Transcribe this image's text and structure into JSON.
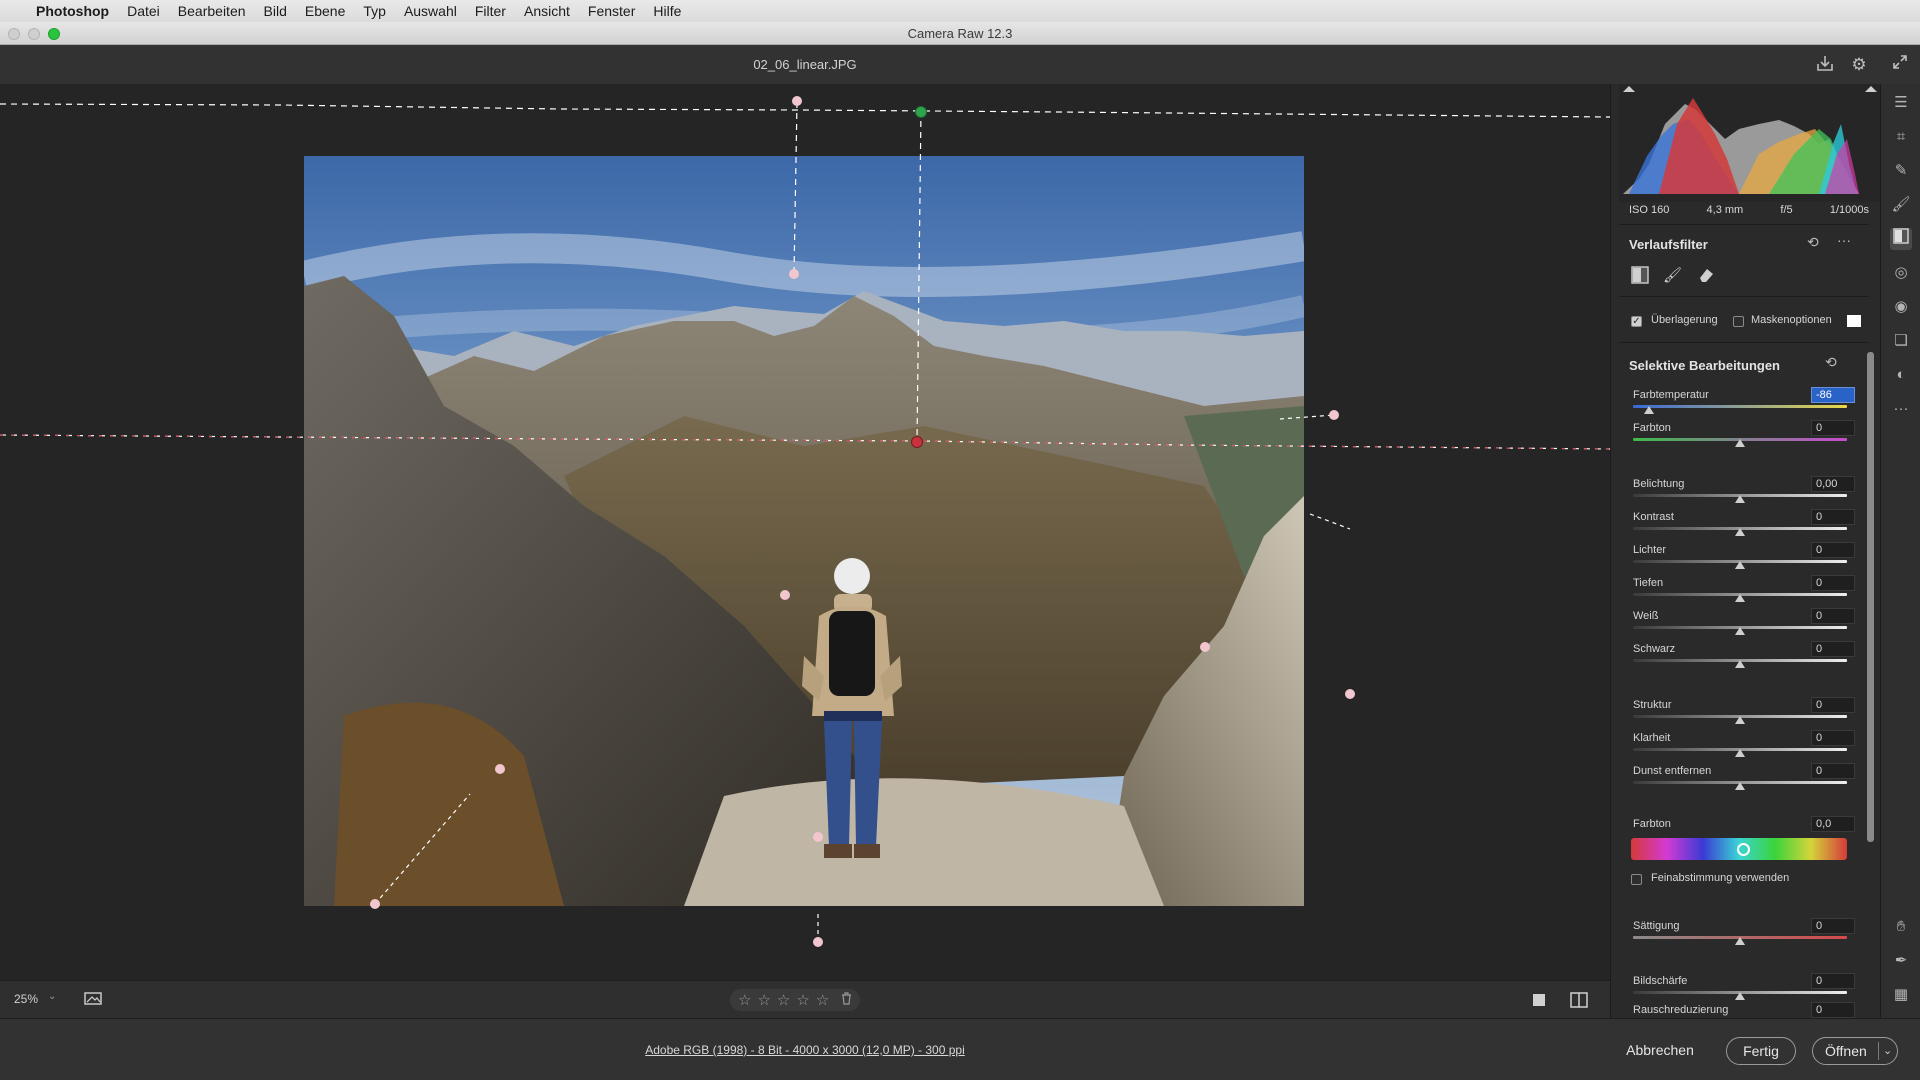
{
  "menubar": {
    "app": "Photoshop",
    "items": [
      "Datei",
      "Bearbeiten",
      "Bild",
      "Ebene",
      "Typ",
      "Auswahl",
      "Filter",
      "Ansicht",
      "Fenster",
      "Hilfe"
    ]
  },
  "window": {
    "title": "Camera Raw 12.3"
  },
  "header": {
    "filename": "02_06_linear.JPG",
    "icons": [
      "save-icon",
      "gear-icon",
      "fullscreen-icon"
    ]
  },
  "histogram": {
    "iso": "ISO 160",
    "focal": "4,3 mm",
    "aperture": "f/5",
    "shutter": "1/1000s"
  },
  "panel": {
    "title": "Verlaufsfilter",
    "overlay_label": "Überlagerung",
    "overlay_checked": true,
    "mask_label": "Maskenoptionen",
    "mask_checked": false,
    "section_title": "Selektive Bearbeitungen",
    "sliders": [
      {
        "label": "Farbtemperatur",
        "value": "-86",
        "pos": 0.07,
        "selected": true,
        "gradient": "temp"
      },
      {
        "label": "Farbton",
        "value": "0",
        "pos": 0.5,
        "gradient": "tint"
      },
      {
        "label": "Belichtung",
        "value": "0,00",
        "pos": 0.5
      },
      {
        "label": "Kontrast",
        "value": "0",
        "pos": 0.5
      },
      {
        "label": "Lichter",
        "value": "0",
        "pos": 0.5
      },
      {
        "label": "Tiefen",
        "value": "0",
        "pos": 0.5
      },
      {
        "label": "Weiß",
        "value": "0",
        "pos": 0.5
      },
      {
        "label": "Schwarz",
        "value": "0",
        "pos": 0.5
      },
      {
        "label": "Struktur",
        "value": "0",
        "pos": 0.5
      },
      {
        "label": "Klarheit",
        "value": "0",
        "pos": 0.5
      },
      {
        "label": "Dunst entfernen",
        "value": "0",
        "pos": 0.5
      }
    ],
    "color_label": "Farbton",
    "color_value": "0,0",
    "fine_tune_label": "Feinabstimmung verwenden",
    "fine_tune_checked": false,
    "sliders2": [
      {
        "label": "Sättigung",
        "value": "0",
        "pos": 0.5,
        "gradient": "sat"
      },
      {
        "label": "Bildschärfe",
        "value": "0",
        "pos": 0.5
      },
      {
        "label": "Rauschreduzierung",
        "value": "0",
        "pos": 0.5
      }
    ]
  },
  "canvas": {
    "zoom": "25%",
    "stars": [
      "☆",
      "☆",
      "☆",
      "☆",
      "☆"
    ],
    "trash_icon": "trash-icon"
  },
  "footer": {
    "image_info": "Adobe RGB (1998) - 8 Bit - 4000 x 3000 (12,0 MP) - 300 ppi",
    "cancel": "Abbrechen",
    "done": "Fertig",
    "open": "Öffnen"
  },
  "colors": {
    "accent": "#2a63c7",
    "pin_red": "#c8323c",
    "pin_green": "#2fa44f",
    "pin_pink": "#f2c6cf"
  }
}
